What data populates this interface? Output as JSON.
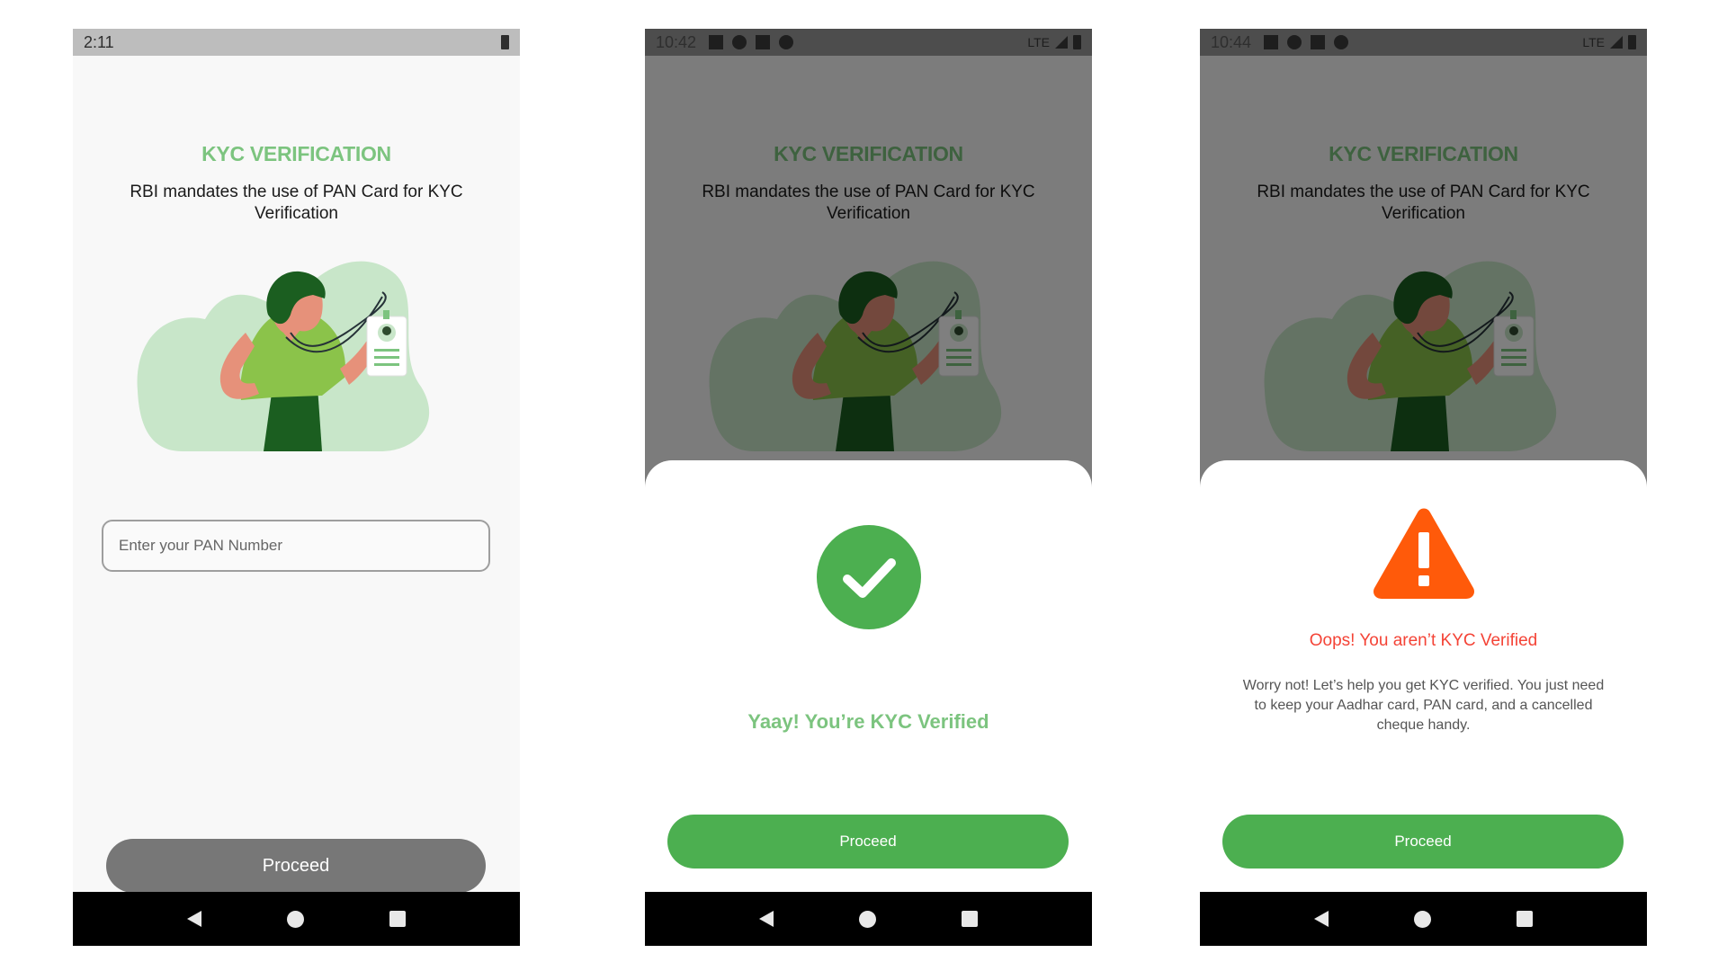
{
  "screens": [
    {
      "statusbar": {
        "time": "2:11"
      },
      "title": "KYC VERIFICATION",
      "subtitle": "RBI mandates the use of PAN Card for KYC Verification",
      "pan_input": {
        "placeholder": "Enter your PAN Number",
        "value": ""
      },
      "proceed_label": "Proceed"
    },
    {
      "statusbar": {
        "time": "10:42",
        "network": "LTE"
      },
      "title": "KYC VERIFICATION",
      "subtitle": "RBI mandates the use of PAN Card for KYC Verification",
      "sheet": {
        "message": "Yaay! You’re KYC Verified",
        "proceed_label": "Proceed"
      }
    },
    {
      "statusbar": {
        "time": "10:44",
        "network": "LTE"
      },
      "title": "KYC VERIFICATION",
      "subtitle": "RBI mandates the use of PAN Card for KYC Verification",
      "sheet": {
        "error_title": "Oops! You aren’t KYC Verified",
        "error_body": "Worry not! Let’s help you get KYC verified. You just need to keep your Aadhar card, PAN card, and a cancelled cheque handy.",
        "proceed_label": "Proceed"
      }
    }
  ],
  "icons": {
    "navbar": [
      "back-icon",
      "home-icon",
      "recents-icon"
    ],
    "success": "check-icon",
    "error": "warning-icon"
  },
  "colors": {
    "accent_green": "#4caf50",
    "title_green": "#7cc47f",
    "error_red": "#f44336",
    "warning_orange": "#ff5a0a",
    "disabled_button": "#777777"
  }
}
